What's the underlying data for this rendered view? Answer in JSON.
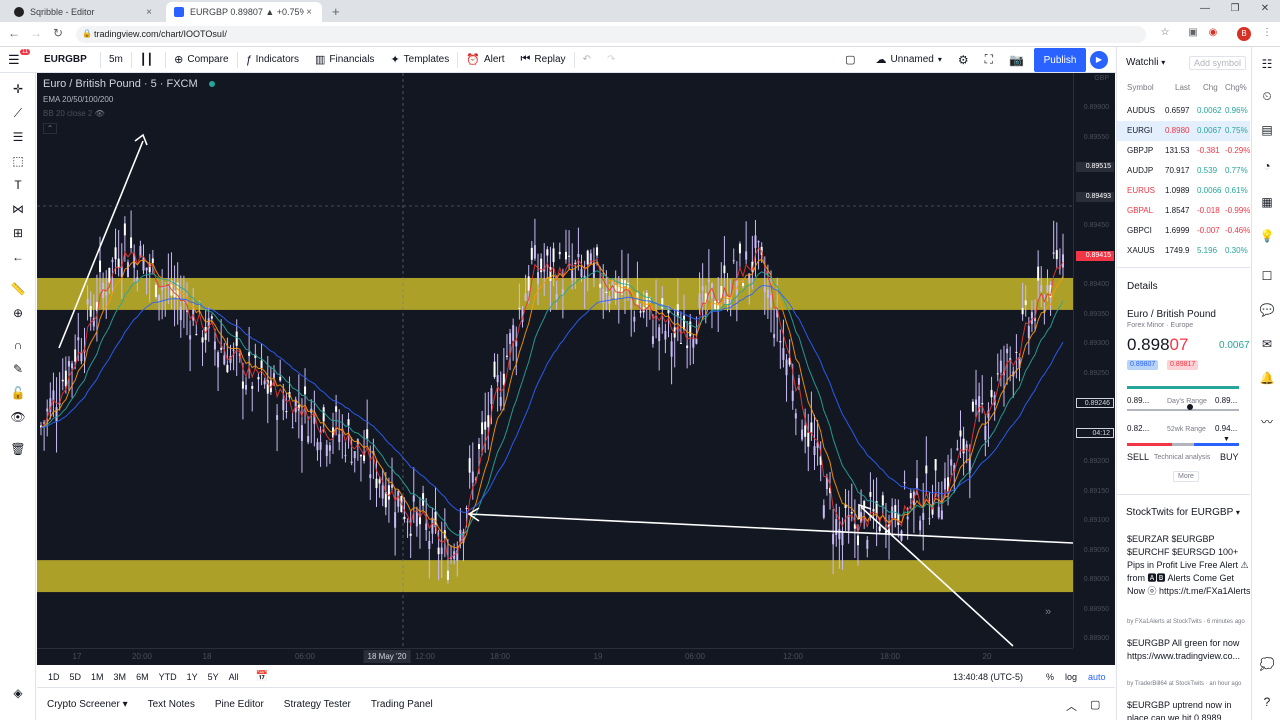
{
  "browser": {
    "tabs": [
      {
        "title": "Sqribble - Editor",
        "active": false
      },
      {
        "title": "EURGBP 0.89807 ▲ +0.75% Unn",
        "active": true
      }
    ],
    "url": "tradingview.com/chart/IOOTOsuI/",
    "new_tab": "+",
    "close": "×",
    "avatar_letter": "B"
  },
  "toolbar": {
    "menu_badge": "11",
    "symbol": "EURGBP",
    "interval": "5m",
    "compare": "Compare",
    "indicators": "Indicators",
    "financials": "Financials",
    "templates": "Templates",
    "alert": "Alert",
    "replay": "Replay",
    "layout_name": "Unnamed",
    "publish": "Publish"
  },
  "chart": {
    "legend_title": "Euro / British Pound · 5 · FXCM",
    "legend_ema": "EMA 20/50/100/200",
    "legend_bb": "BB 20 close 2",
    "price_ticks": [
      "GBP",
      "0.89900",
      "0.89550",
      "0.89515",
      "0.89493",
      "0.89450",
      "0.89415",
      "0.89400",
      "0.89350",
      "0.89300",
      "0.89250",
      "0.89246",
      "04:12",
      "0.89200",
      "0.89150",
      "0.89100",
      "0.89050",
      "0.89000",
      "0.88950",
      "0.88900"
    ],
    "time_ticks": [
      "17",
      "20:00",
      "18",
      "06:00",
      "18 May '20",
      "12:00",
      "18:00",
      "19",
      "06:00",
      "12:00",
      "18:00",
      "20"
    ],
    "colors": {
      "background": "#131722",
      "zone": "#c8b82a",
      "candles": "#c9bbf5",
      "ema20": "#e53935",
      "ema50": "#ff9800",
      "ema100": "#26a69a",
      "ema200": "#2962ff"
    }
  },
  "chart_data": {
    "type": "line",
    "title": "Euro / British Pound · 5 · FXCM",
    "xlabel": "",
    "ylabel": "",
    "ylim": [
      0.889,
      0.8995
    ],
    "x_ticks": [
      "17",
      "20:00",
      "18",
      "06:00",
      "18 May '20",
      "12:00",
      "18:00",
      "19",
      "06:00",
      "12:00",
      "18:00",
      "20"
    ],
    "series": [
      {
        "name": "EURGBP",
        "x": [
          0,
          8,
          20,
          30,
          40,
          48,
          55,
          62,
          70,
          78,
          88,
          100
        ],
        "y": [
          0.893,
          0.8965,
          0.894,
          0.8928,
          0.8905,
          0.896,
          0.8958,
          0.8947,
          0.8962,
          0.891,
          0.8918,
          0.8962
        ]
      }
    ],
    "resistance_zone": [
      0.8952,
      0.8958
    ],
    "support_zone": [
      0.8899,
      0.8905
    ]
  },
  "bottom": {
    "ranges": [
      "1D",
      "5D",
      "1M",
      "3M",
      "6M",
      "YTD",
      "1Y",
      "5Y",
      "All"
    ],
    "clock": "13:40:48 (UTC-5)",
    "percent": "%",
    "log": "log",
    "auto": "auto",
    "panels": [
      "Crypto Screener",
      "Text Notes",
      "Pine Editor",
      "Strategy Tester",
      "Trading Panel"
    ]
  },
  "watchlist": {
    "title": "Watchli",
    "add": "Add symbol",
    "cols": [
      "Symbol",
      "Last",
      "Chg",
      "Chg%"
    ],
    "rows": [
      {
        "sym": "AUDUS",
        "last": "0.6597",
        "chg": "0.0062",
        "pct": "0.96%",
        "up": true,
        "flag": false,
        "sel": false
      },
      {
        "sym": "EURGI",
        "last": "0.8980",
        "chg": "0.0067",
        "pct": "0.75%",
        "up": true,
        "flag": false,
        "sel": true
      },
      {
        "sym": "GBPJP",
        "last": "131.53",
        "chg": "-0.381",
        "pct": "-0.29%",
        "up": false,
        "flag": false,
        "sel": false
      },
      {
        "sym": "AUDJP",
        "last": "70.917",
        "chg": "0.539",
        "pct": "0.77%",
        "up": true,
        "flag": false,
        "sel": false
      },
      {
        "sym": "EURUS",
        "last": "1.0989",
        "chg": "0.0066",
        "pct": "0.61%",
        "up": true,
        "flag": true,
        "sel": false
      },
      {
        "sym": "GBPAL",
        "last": "1.8547",
        "chg": "-0.018",
        "pct": "-0.99%",
        "up": false,
        "flag": true,
        "sel": false
      },
      {
        "sym": "GBPCI",
        "last": "1.6999",
        "chg": "-0.007",
        "pct": "-0.46%",
        "up": false,
        "flag": false,
        "sel": false
      },
      {
        "sym": "XAUUS",
        "last": "1749.9",
        "chg": "5.196",
        "pct": "0.30%",
        "up": true,
        "flag": false,
        "sel": false
      }
    ]
  },
  "details": {
    "title": "Details",
    "name": "Euro / British Pound",
    "sub": "Forex Minor · Europe",
    "price": "0.89807",
    "change": "0.00671",
    "bid": "0.89807",
    "ask": "0.89817",
    "day_low": "0.89...",
    "day_high": "0.89...",
    "day_label": "Day's Range",
    "wk_low": "0.82...",
    "wk_high": "0.94...",
    "wk_label": "52wk Range",
    "sell": "SELL",
    "buy": "BUY",
    "ta_label": "Technical analysis",
    "more": "More"
  },
  "stocktwits": {
    "title": "StockTwits for EURGBP",
    "posts": [
      {
        "text": "$EURZAR $EURGBP $EURCHF $EURSGD 100+ Pips in Profit Live Free Alert ⚠ from 🅰🅱 Alerts Come Get Now ⓞ https://t.me/FXa1Alerts",
        "meta": "by FXa1Alerts at StockTwits · 6 minutes ago"
      },
      {
        "text": "$EURGBP All green for now https://www.tradingview.co...",
        "meta": "by TraderBill64 at StockTwits · an hour ago"
      },
      {
        "text": "$EURGBP uptrend now in place can we hit 0.8989",
        "meta": ""
      }
    ]
  }
}
